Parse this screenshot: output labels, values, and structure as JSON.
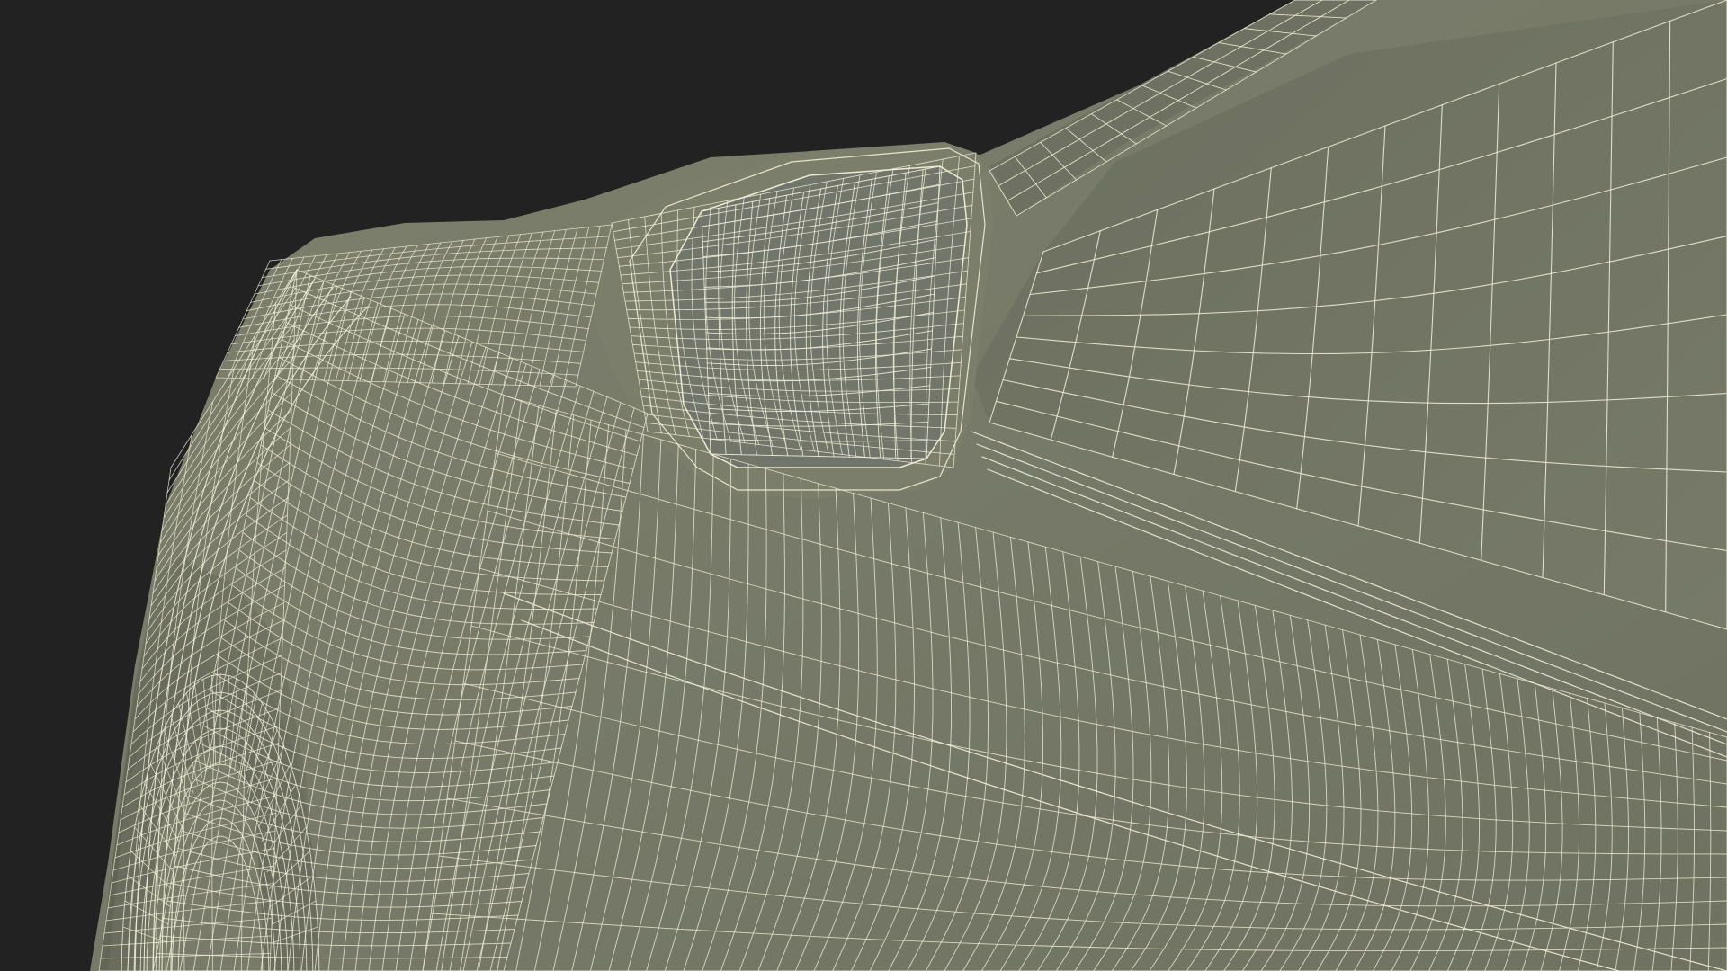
{
  "scene": {
    "background_color": "#222222",
    "body_color": "#777a68",
    "body_shadow_color": "#5d6052",
    "body_highlight_color": "#858874",
    "wire_color": "#f2f0da"
  }
}
